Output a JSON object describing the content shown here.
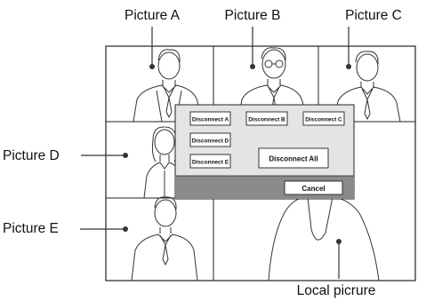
{
  "callouts": {
    "picture_a": "Picture A",
    "picture_b": "Picture B",
    "picture_c": "Picture C",
    "picture_d": "Picture D",
    "picture_e": "Picture E",
    "local": "Local picrure"
  },
  "dialog": {
    "disconnect_a": "Disconnect A",
    "disconnect_b": "Disconnect B",
    "disconnect_c": "Disconnect C",
    "disconnect_d": "Disconnect D",
    "disconnect_e": "Disconnect E",
    "disconnect_all": "Disconnect All",
    "cancel": "Cancel"
  },
  "colors": {
    "dialog_bar": "#8a8a8a",
    "dialog_body": "#e4e4e4",
    "frame": "#222222",
    "screen": "#ffffff"
  }
}
